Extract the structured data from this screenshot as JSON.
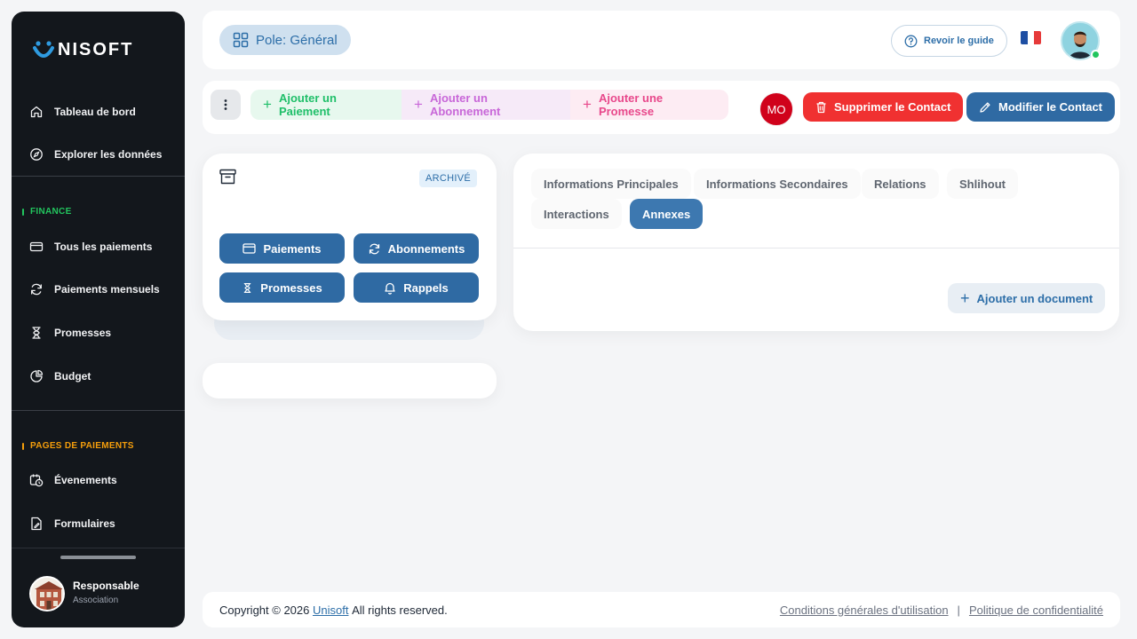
{
  "brand": {
    "name": "NISOFT",
    "logo_letter": "U"
  },
  "sidebar": {
    "main_items": [
      {
        "label": "Tableau de bord",
        "icon": "home-icon"
      },
      {
        "label": "Explorer les données",
        "icon": "compass-icon"
      }
    ],
    "finance": {
      "title": "FINANCE",
      "color": "#22c55e",
      "items": [
        {
          "label": "Tous les paiements",
          "icon": "card-icon"
        },
        {
          "label": "Paiements mensuels",
          "icon": "refresh-icon"
        },
        {
          "label": "Promesses",
          "icon": "hourglass-icon"
        },
        {
          "label": "Budget",
          "icon": "pie-icon"
        }
      ]
    },
    "pages": {
      "title": "PAGES DE PAIEMENTS",
      "color": "#f59e0b",
      "items": [
        {
          "label": "Évenements",
          "icon": "calendar-clock-icon"
        },
        {
          "label": "Formulaires",
          "icon": "form-icon"
        }
      ]
    },
    "user": {
      "name": "Responsable",
      "role": "Association"
    }
  },
  "header": {
    "pole_label": "Pole: Général",
    "guide_label": "Revoir le guide",
    "language": "fr"
  },
  "actions": {
    "add_payment": "Ajouter un Paiement",
    "add_subscription": "Ajouter un Abonnement",
    "add_promise": "Ajouter une Promesse",
    "initials": "MO",
    "delete_contact": "Supprimer le Contact",
    "edit_contact": "Modifier le Contact"
  },
  "contact_card": {
    "status_badge": "ARCHIVÉ",
    "buttons": [
      "Paiements",
      "Abonnements",
      "Promesses",
      "Rappels"
    ]
  },
  "detail_panel": {
    "tabs": [
      "Informations Principales",
      "Informations Secondaires",
      "Relations",
      "Shlihout",
      "Interactions",
      "Annexes"
    ],
    "active_tab": "Annexes",
    "add_document": "Ajouter un document"
  },
  "footer": {
    "copyright_prefix": "Copyright © 2026",
    "company_link": "Unisoft",
    "rights": "All rights reserved.",
    "terms": "Conditions générales d'utilisation",
    "separator": "|",
    "privacy": "Politique de confidentialité"
  }
}
